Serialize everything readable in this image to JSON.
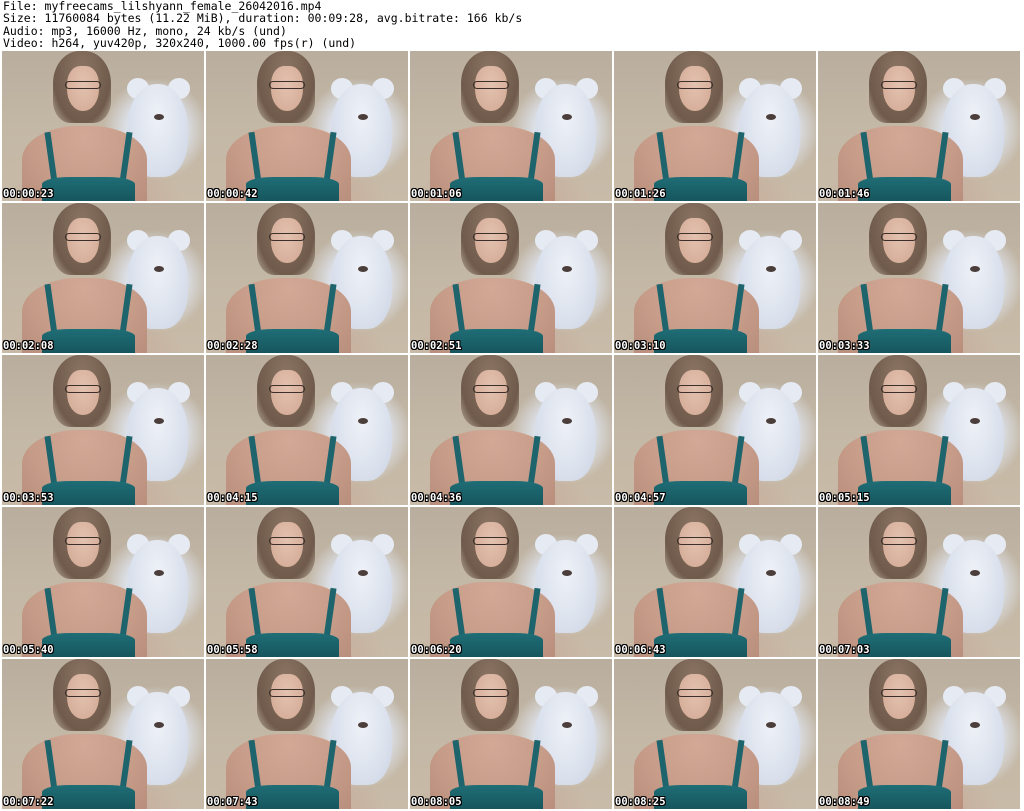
{
  "header": {
    "line_file": "File: myfreecams_lilshyann_female_26042016.mp4",
    "line_size": "Size: 11760084 bytes (11.22 MiB), duration: 00:09:28, avg.bitrate: 166 kb/s",
    "line_audio": "Audio: mp3, 16000 Hz, mono, 24 kb/s (und)",
    "line_video": "Video: h264, yuv420p, 320x240, 1000.00 fps(r) (und)"
  },
  "thumbnails": [
    {
      "timestamp": "00:00:23"
    },
    {
      "timestamp": "00:00:42"
    },
    {
      "timestamp": "00:01:06"
    },
    {
      "timestamp": "00:01:26"
    },
    {
      "timestamp": "00:01:46"
    },
    {
      "timestamp": "00:02:08"
    },
    {
      "timestamp": "00:02:28"
    },
    {
      "timestamp": "00:02:51"
    },
    {
      "timestamp": "00:03:10"
    },
    {
      "timestamp": "00:03:33"
    },
    {
      "timestamp": "00:03:53"
    },
    {
      "timestamp": "00:04:15"
    },
    {
      "timestamp": "00:04:36"
    },
    {
      "timestamp": "00:04:57"
    },
    {
      "timestamp": "00:05:15"
    },
    {
      "timestamp": "00:05:40"
    },
    {
      "timestamp": "00:05:58"
    },
    {
      "timestamp": "00:06:20"
    },
    {
      "timestamp": "00:06:43"
    },
    {
      "timestamp": "00:07:03"
    },
    {
      "timestamp": "00:07:22"
    },
    {
      "timestamp": "00:07:43"
    },
    {
      "timestamp": "00:08:05"
    },
    {
      "timestamp": "00:08:25"
    },
    {
      "timestamp": "00:08:49"
    }
  ]
}
